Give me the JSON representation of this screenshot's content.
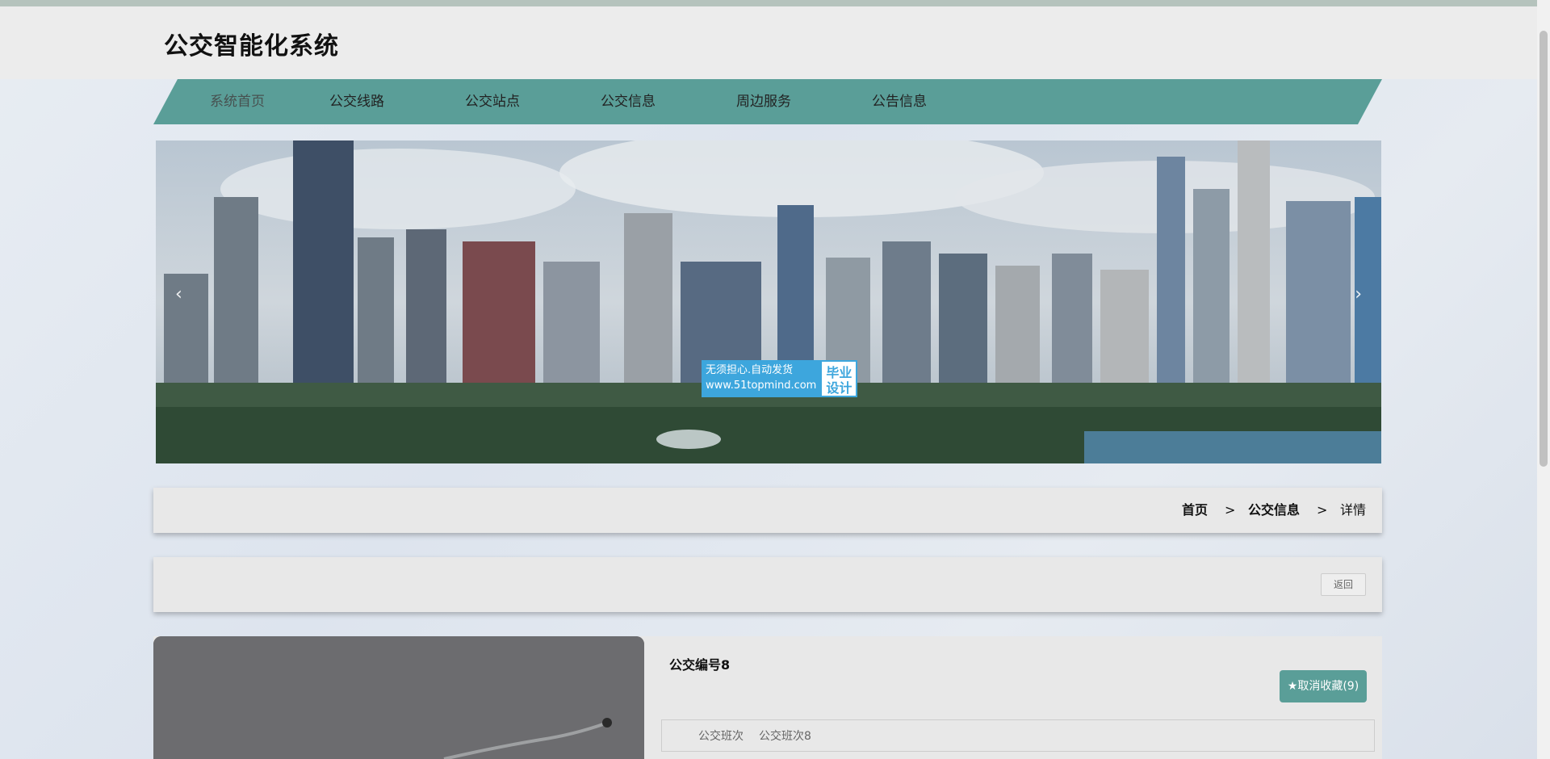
{
  "site": {
    "title": "公交智能化系统"
  },
  "nav": {
    "items": [
      "系统首页",
      "公交线路",
      "公交站点",
      "公交信息",
      "周边服务",
      "公告信息"
    ]
  },
  "banner": {
    "prev_glyph": "‹",
    "next_glyph": "›",
    "watermark_line1": "无须担心.自动发货",
    "watermark_line2": "www.51topmind.com",
    "watermark_right1": "毕业",
    "watermark_right2": "设计"
  },
  "breadcrumb": {
    "home": "首页",
    "sep": ">",
    "section": "公交信息",
    "current": "详情"
  },
  "actions": {
    "back_label": "返回"
  },
  "detail": {
    "title": "公交编号8",
    "favorite_label": "★取消收藏(9)",
    "fields": [
      {
        "label": "公交班次",
        "value": "公交班次8"
      }
    ]
  },
  "colors": {
    "accent": "#5a9e98",
    "nav_bg": "#5a9e98"
  }
}
